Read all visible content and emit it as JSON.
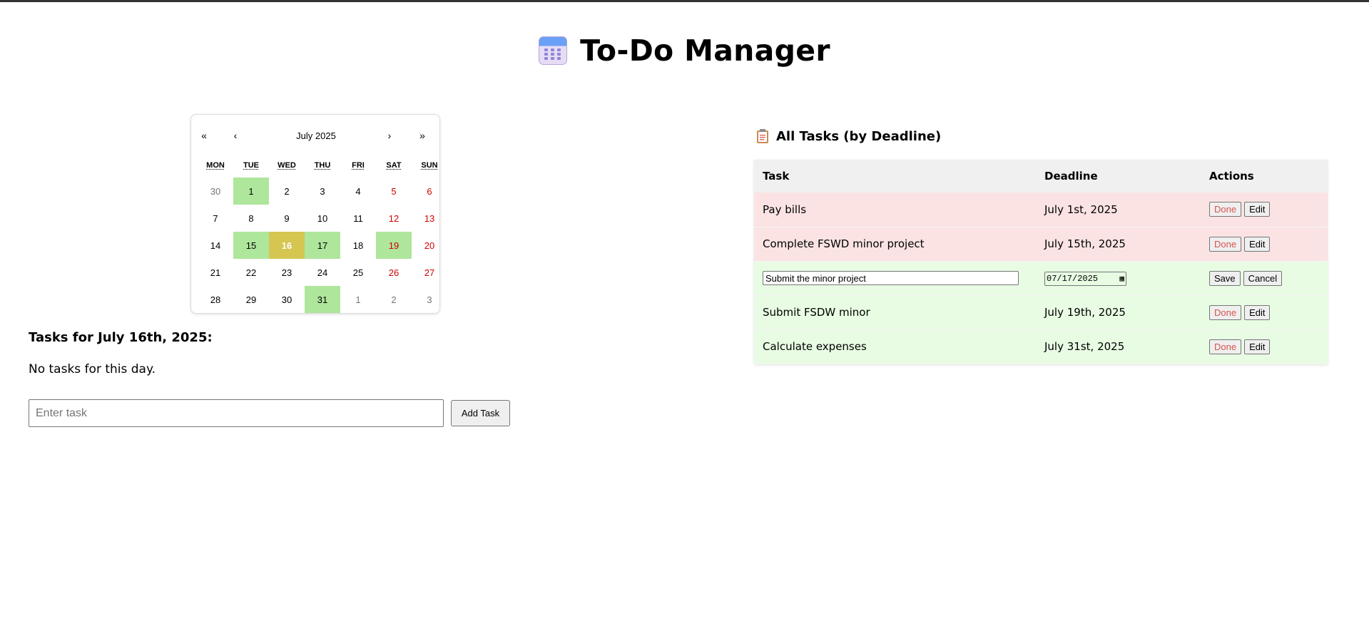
{
  "header": {
    "title": "To-Do Manager",
    "icon": "calendar-icon"
  },
  "calendar": {
    "nav": {
      "prev_year": "«",
      "prev_month": "‹",
      "month_label": "July 2025",
      "next_month": "›",
      "next_year": "»"
    },
    "weekdays": [
      "MON",
      "TUE",
      "WED",
      "THU",
      "FRI",
      "SAT",
      "SUN"
    ],
    "days": [
      {
        "label": "30",
        "type": "other"
      },
      {
        "label": "1",
        "type": "task"
      },
      {
        "label": "2",
        "type": ""
      },
      {
        "label": "3",
        "type": ""
      },
      {
        "label": "4",
        "type": ""
      },
      {
        "label": "5",
        "type": "weekend"
      },
      {
        "label": "6",
        "type": "weekend"
      },
      {
        "label": "7",
        "type": ""
      },
      {
        "label": "8",
        "type": ""
      },
      {
        "label": "9",
        "type": ""
      },
      {
        "label": "10",
        "type": ""
      },
      {
        "label": "11",
        "type": ""
      },
      {
        "label": "12",
        "type": "weekend"
      },
      {
        "label": "13",
        "type": "weekend"
      },
      {
        "label": "14",
        "type": ""
      },
      {
        "label": "15",
        "type": "task"
      },
      {
        "label": "16",
        "type": "selected"
      },
      {
        "label": "17",
        "type": "task"
      },
      {
        "label": "18",
        "type": ""
      },
      {
        "label": "19",
        "type": "weekend task"
      },
      {
        "label": "20",
        "type": "weekend"
      },
      {
        "label": "21",
        "type": ""
      },
      {
        "label": "22",
        "type": ""
      },
      {
        "label": "23",
        "type": ""
      },
      {
        "label": "24",
        "type": ""
      },
      {
        "label": "25",
        "type": ""
      },
      {
        "label": "26",
        "type": "weekend"
      },
      {
        "label": "27",
        "type": "weekend"
      },
      {
        "label": "28",
        "type": ""
      },
      {
        "label": "29",
        "type": ""
      },
      {
        "label": "30",
        "type": ""
      },
      {
        "label": "31",
        "type": "task"
      },
      {
        "label": "1",
        "type": "other"
      },
      {
        "label": "2",
        "type": "other"
      },
      {
        "label": "3",
        "type": "other"
      }
    ]
  },
  "day_panel": {
    "title": "Tasks for July 16th, 2025:",
    "empty_message": "No tasks for this day.",
    "input_placeholder": "Enter task",
    "add_button": "Add Task"
  },
  "all_tasks": {
    "title": "All Tasks (by Deadline)",
    "icon": "clipboard-icon",
    "columns": [
      "Task",
      "Deadline",
      "Actions"
    ],
    "rows": [
      {
        "task": "Pay bills",
        "deadline": "July 1st, 2025",
        "status": "overdue",
        "editing": false
      },
      {
        "task": "Complete FSWD minor project",
        "deadline": "July 15th, 2025",
        "status": "overdue",
        "editing": false
      },
      {
        "task": "Submit the minor project",
        "deadline": "07/17/2025",
        "status": "upcoming",
        "editing": true
      },
      {
        "task": "Submit FSDW minor",
        "deadline": "July 19th, 2025",
        "status": "upcoming",
        "editing": false
      },
      {
        "task": "Calculate expenses",
        "deadline": "July 31st, 2025",
        "status": "upcoming",
        "editing": false
      }
    ],
    "done_label": "Done",
    "edit_label": "Edit",
    "save_label": "Save",
    "cancel_label": "Cancel"
  },
  "colors": {
    "task_day": "#aee69c",
    "selected_day": "#d4c650",
    "overdue_row": "#fbe3e3",
    "upcoming_row": "#e8fce3",
    "weekend_text": "#d10000",
    "done_text": "#d9534f"
  }
}
